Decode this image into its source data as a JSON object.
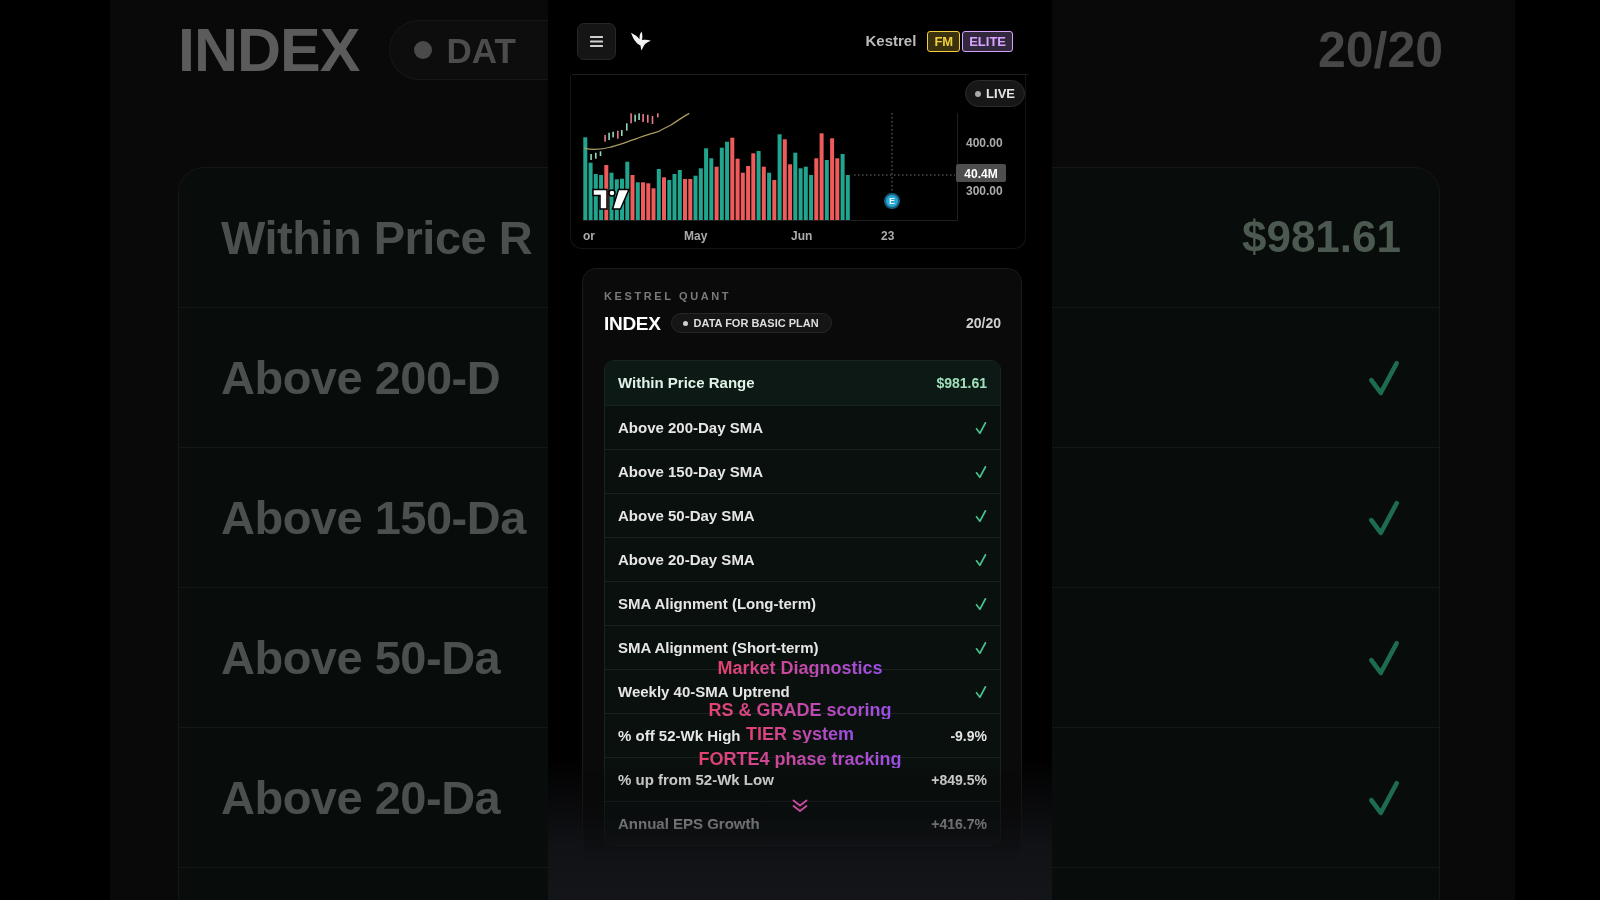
{
  "backdrop": {
    "title": "INDEX",
    "tag": "DAT",
    "score": "20/20",
    "rows": [
      {
        "label": "Within Price R",
        "kind": "value",
        "value": "$981.61"
      },
      {
        "label": "Above 200-D",
        "kind": "check",
        "passed": true
      },
      {
        "label": "Above 150-Da",
        "kind": "check",
        "passed": true
      },
      {
        "label": "Above 50-Da",
        "kind": "check",
        "passed": true
      },
      {
        "label": "Above 20-Da",
        "kind": "check",
        "passed": true
      }
    ]
  },
  "header": {
    "brand": "Kestrel",
    "badges": [
      {
        "label": "FM",
        "color": "#f2cf3c"
      },
      {
        "label": "ELITE",
        "color": "#d7a3ff"
      }
    ]
  },
  "chart": {
    "status": "LIVE",
    "y_labels": [
      "400.00",
      "300.00"
    ],
    "crosshair_value": "40.4M",
    "event_marker": "E",
    "x_labels": [
      "or",
      "May",
      "Jun",
      "23"
    ]
  },
  "panel": {
    "eyebrow": "KESTREL QUANT",
    "title": "INDEX",
    "tag": "DATA FOR BASIC PLAN",
    "score": "20/20",
    "rows": [
      {
        "label": "Within Price Range",
        "kind": "value",
        "value": "$981.61",
        "highlighted": true
      },
      {
        "label": "Above 200-Day SMA",
        "kind": "check",
        "passed": true,
        "highlighted": false
      },
      {
        "label": "Above 150-Day SMA",
        "kind": "check",
        "passed": true,
        "highlighted": false
      },
      {
        "label": "Above 50-Day SMA",
        "kind": "check",
        "passed": true,
        "highlighted": false
      },
      {
        "label": "Above 20-Day SMA",
        "kind": "check",
        "passed": true,
        "highlighted": false
      },
      {
        "label": "SMA Alignment (Long-term)",
        "kind": "check",
        "passed": true,
        "highlighted": false
      },
      {
        "label": "SMA Alignment (Short-term)",
        "kind": "check",
        "passed": true,
        "highlighted": false
      },
      {
        "label": "Weekly 40-SMA Uptrend",
        "kind": "check",
        "passed": true,
        "highlighted": false
      },
      {
        "label": "% off 52-Wk High",
        "kind": "value",
        "value": "-9.9%",
        "highlighted": false
      },
      {
        "label": "% up from 52-Wk Low",
        "kind": "value",
        "value": "+849.5%",
        "highlighted": false
      },
      {
        "label": "Annual EPS Growth",
        "kind": "value",
        "value": "+416.7%",
        "highlighted": false
      }
    ]
  },
  "captions": [
    "Market Diagnostics",
    "RS & GRADE scoring",
    "TIER system",
    "FORTE4 phase tracking"
  ]
}
